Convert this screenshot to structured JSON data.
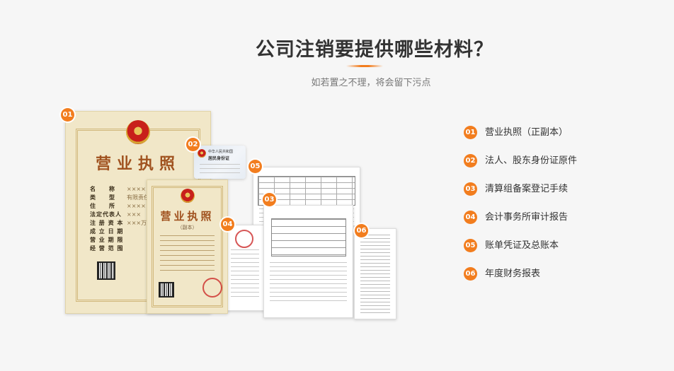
{
  "header": {
    "title": "公司注销要提供哪些材料？",
    "subtitle": "如若置之不理，将会留下污点",
    "accent_color": "#f27d1e"
  },
  "documents": {
    "business_license_original": {
      "badge": "01",
      "title": "营业执照",
      "fields": [
        {
          "key": "名　　称",
          "value": "×××××××××"
        },
        {
          "key": "类　　型",
          "value": "有限责任公司"
        },
        {
          "key": "住　　所",
          "value": "××××××市××××"
        },
        {
          "key": "法定代表人",
          "value": "×××"
        },
        {
          "key": "注 册 资 本",
          "value": "×××万元整"
        },
        {
          "key": "成 立 日 期",
          "value": ""
        },
        {
          "key": "营 业 期 限",
          "value": ""
        },
        {
          "key": "经 营 范 围",
          "value": ""
        }
      ]
    },
    "id_card": {
      "badge": "02",
      "line1": "中华人民共和国",
      "line2": "居民身份证"
    },
    "liquidation_form": {
      "badge": "03"
    },
    "audit_report": {
      "badge": "04"
    },
    "ledger": {
      "badge": "05"
    },
    "financial_report": {
      "badge": "06"
    },
    "business_license_copy": {
      "title": "营业执照",
      "subtitle": "（副本）"
    }
  },
  "materials": [
    {
      "num": "01",
      "label": "营业执照（正副本）"
    },
    {
      "num": "02",
      "label": "法人、股东身份证原件"
    },
    {
      "num": "03",
      "label": "清算组备案登记手续"
    },
    {
      "num": "04",
      "label": "会计事务所审计报告"
    },
    {
      "num": "05",
      "label": "账单凭证及总账本"
    },
    {
      "num": "06",
      "label": "年度财务报表"
    }
  ]
}
